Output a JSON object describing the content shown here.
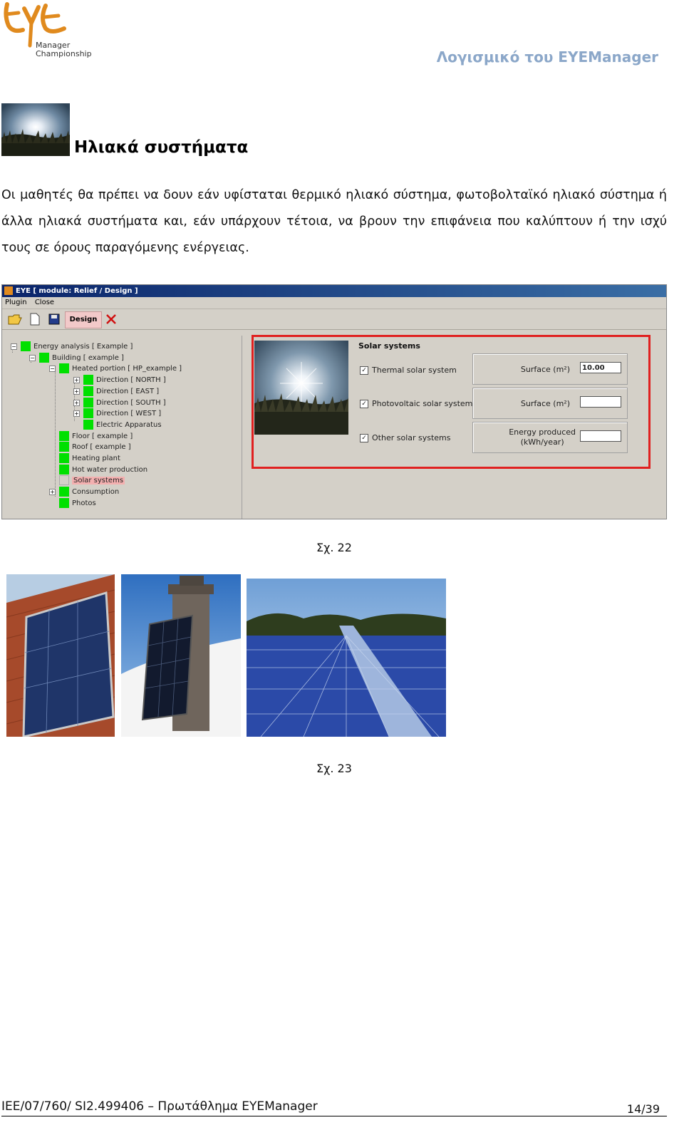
{
  "header": {
    "logo_text": "EYE",
    "logo_line1": "Manager",
    "logo_line2": "Championship",
    "title": "Λογισμικό του EYEManager"
  },
  "section": {
    "title": "Ηλιακά συστήματα",
    "intro": "Οι μαθητές θα πρέπει να δουν εάν υφίσταται θερμικό ηλιακό σύστημα, φωτοβολταϊκό ηλιακό σύστημα ή άλλα ηλιακά συστήματα και, εάν υπάρχουν τέτοια, να βρουν την επιφάνεια που καλύπτουν ή την ισχύ τους σε όρους παραγόμενης ενέργειας."
  },
  "window": {
    "title": "EYE  [ module: Relief / Design ]",
    "menu": [
      "Plugin",
      "Close"
    ],
    "design_button": "Design",
    "tree": [
      {
        "label": "Energy analysis [ Example ]",
        "depth": 0,
        "expander": "−",
        "square": "green"
      },
      {
        "label": "Building [ example ]",
        "depth": 1,
        "expander": "−",
        "square": "green"
      },
      {
        "label": "Heated portion [ HP_example ]",
        "depth": 2,
        "expander": "−",
        "square": "green"
      },
      {
        "label": "Direction [ NORTH ]",
        "depth": 3,
        "expander": "+",
        "square": "green"
      },
      {
        "label": "Direction [ EAST ]",
        "depth": 3,
        "expander": "+",
        "square": "green"
      },
      {
        "label": "Direction [ SOUTH ]",
        "depth": 3,
        "expander": "+",
        "square": "green"
      },
      {
        "label": "Direction [ WEST ]",
        "depth": 3,
        "expander": "+",
        "square": "green"
      },
      {
        "label": "Electric Apparatus",
        "depth": 3,
        "expander": "",
        "square": "green"
      },
      {
        "label": "Floor [ example ]",
        "depth": 2,
        "expander": "",
        "square": "green"
      },
      {
        "label": "Roof [ example ]",
        "depth": 2,
        "expander": "",
        "square": "green"
      },
      {
        "label": "Heating plant",
        "depth": 2,
        "expander": "",
        "square": "green"
      },
      {
        "label": "Hot water production",
        "depth": 2,
        "expander": "",
        "square": "green"
      },
      {
        "label": "Solar systems",
        "depth": 2,
        "expander": "",
        "square": "gray",
        "selected": true
      },
      {
        "label": "Consumption",
        "depth": 2,
        "expander": "+",
        "square": "green"
      },
      {
        "label": "Photos",
        "depth": 2,
        "expander": "",
        "square": "green"
      }
    ],
    "solar": {
      "heading": "Solar systems",
      "thermal_label": "Thermal solar system",
      "pv_label": "Photovoltaic solar system",
      "other_label": "Other solar systems",
      "thermal_checked": true,
      "pv_checked": true,
      "other_checked": true,
      "surface_label_1": "Surface (m²)",
      "surface_value_1": "10.00",
      "surface_label_2": "Surface (m²)",
      "surface_value_2": "",
      "energy_label_line1": "Energy produced",
      "energy_label_line2": "(kWh/year)",
      "energy_value": ""
    }
  },
  "captions": {
    "fig22": "Σχ. 22",
    "fig23": "Σχ. 23"
  },
  "footer": {
    "left": "IEE/07/760/ SI2.499406 – Πρωτάθλημα EYEManager",
    "page": "14/39"
  },
  "colors": {
    "header_title": "#8ba7c9",
    "logo_orange": "#e08a1e",
    "highlight_box": "#e02020",
    "tree_square": "#00e000",
    "titlebar": "#0a246a"
  }
}
